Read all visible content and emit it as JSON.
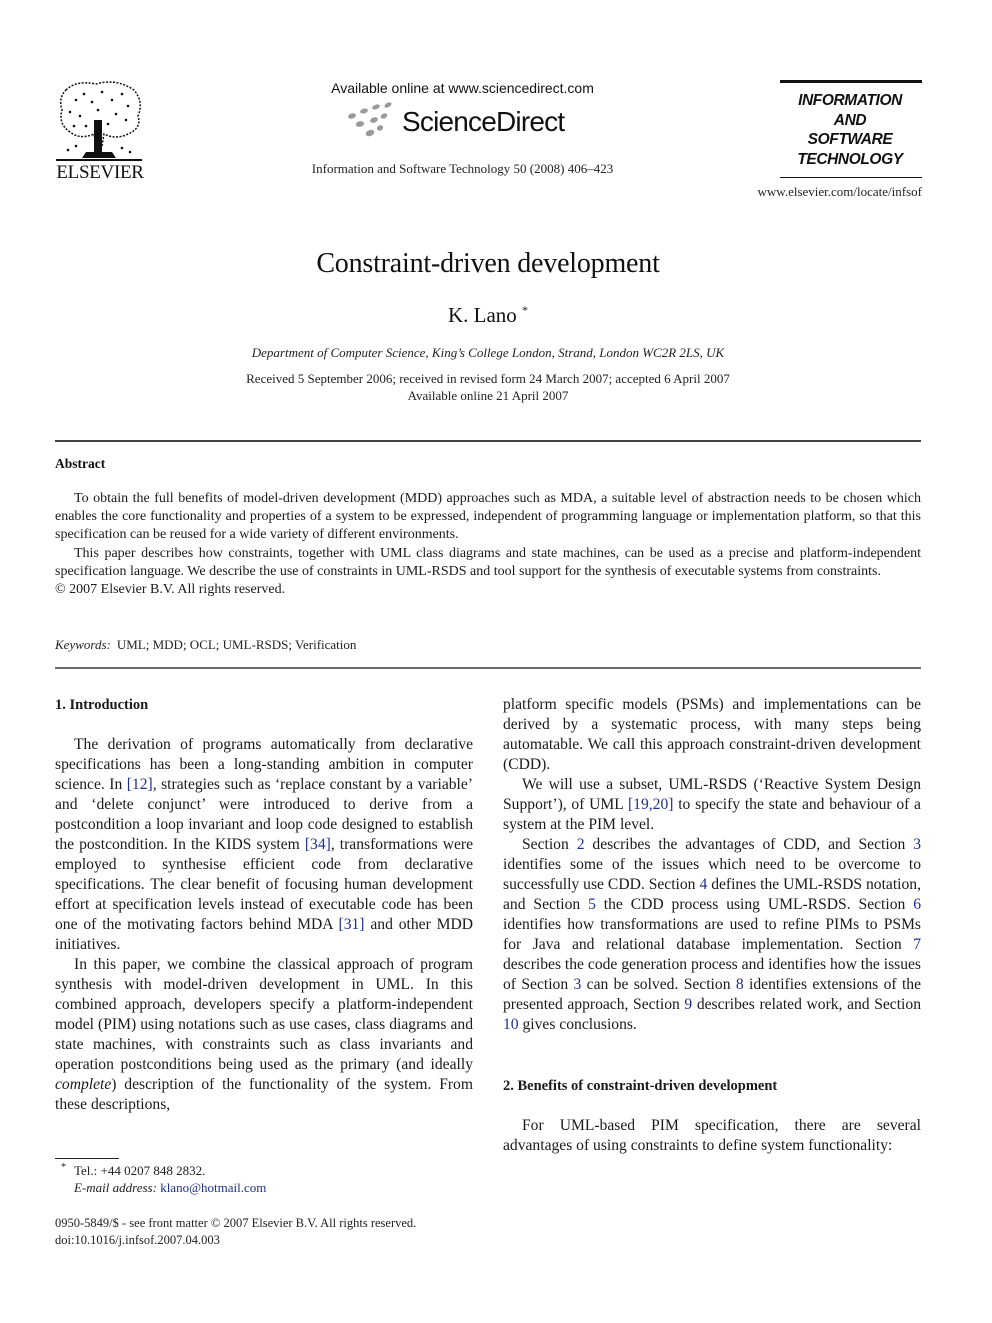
{
  "header": {
    "publisher_logo_icon": "elsevier-tree-icon",
    "publisher_name": "ELSEVIER",
    "available_online": "Available online at www.sciencedirect.com",
    "sciencedirect_logo_icon": "sciencedirect-dots-icon",
    "sciencedirect_name": "ScienceDirect",
    "journal_citation": "Information and Software Technology 50 (2008) 406–423",
    "journal_logo_lines": [
      "INFORMATION",
      "AND",
      "SOFTWARE",
      "TECHNOLOGY"
    ],
    "journal_url": "www.elsevier.com/locate/infsof"
  },
  "article": {
    "title": "Constraint-driven development",
    "author": "K. Lano",
    "author_mark": "*",
    "affiliation": "Department of Computer Science, King’s College London, Strand, London WC2R 2LS, UK",
    "received": "Received 5 September 2006; received in revised form 24 March 2007; accepted 6 April 2007",
    "available": "Available online 21 April 2007"
  },
  "abstract": {
    "heading": "Abstract",
    "paragraphs": [
      "To obtain the full benefits of model-driven development (MDD) approaches such as MDA, a suitable level of abstraction needs to be chosen which enables the core functionality and properties of a system to be expressed, independent of programming language or implementation platform, so that this specification can be reused for a wide variety of different environments.",
      "This paper describes how constraints, together with UML class diagrams and state machines, can be used as a precise and platform-independent specification language. We describe the use of constraints in UML-RSDS and tool support for the synthesis of executable systems from constraints."
    ],
    "copyright": "© 2007 Elsevier B.V. All rights reserved.",
    "keywords_label": "Keywords:",
    "keywords": "UML; MDD; OCL; UML-RSDS; Verification"
  },
  "body": {
    "sec1_heading": "1. Introduction",
    "p1": {
      "a": "The derivation of programs automatically from declarative specifications has been a long-standing ambition in computer science. In ",
      "ref1": "[12]",
      "b": ", strategies such as ‘replace constant by a variable’ and ‘delete conjunct’ were introduced to derive from a postcondition a loop invariant and loop code designed to establish the postcondition. In the KIDS system ",
      "ref2": "[34]",
      "c": ", transformations were employed to synthesise efficient code from declarative specifications. The clear benefit of focusing human development effort at specification levels instead of executable code has been one of the motivating factors behind MDA ",
      "ref3": "[31]",
      "d": " and other MDD initiatives."
    },
    "p2": {
      "a": "In this paper, we combine the classical approach of program synthesis with model-driven development in UML. In this combined approach, developers specify a platform-independent model (PIM) using notations such as use cases, class diagrams and state machines, with constraints such as class invariants and operation postconditions being used as the primary (and ideally ",
      "em": "complete",
      "b": ") description of the functionality of the system. From these descriptions,"
    },
    "p3": "platform specific models (PSMs) and implementations can be derived by a systematic process, with many steps being automatable. We call this approach constraint-driven development (CDD).",
    "p4": {
      "a": "We will use a subset, UML-RSDS (‘Reactive System Design Support’), of UML ",
      "ref": "[19,20]",
      "b": " to specify the state and behaviour of a system at the PIM level."
    },
    "p5": {
      "t0": "Section ",
      "s2": "2",
      "t1": " describes the advantages of CDD, and Section ",
      "s3": "3",
      "t2": " identifies some of the issues which need to be overcome to successfully use CDD. Section ",
      "s4": "4",
      "t3": " defines the UML-RSDS notation, and Section ",
      "s5": "5",
      "t4": " the CDD process using UML-RSDS. Section ",
      "s6": "6",
      "t5": " identifies how transformations are used to refine PIMs to PSMs for Java and relational database implementation. Section ",
      "s7": "7",
      "t6": " describes the code generation process and identifies how the issues of Section ",
      "s3b": "3",
      "t7": " can be solved. Section ",
      "s8": "8",
      "t8": " identifies extensions of the presented approach, Section ",
      "s9": "9",
      "t9": " describes related work, and Section ",
      "s10": "10",
      "t10": " gives conclusions."
    },
    "sec2_heading": "2. Benefits of constraint-driven development",
    "p6": "For UML-based PIM specification, there are several advantages of using constraints to define system functionality:"
  },
  "footnote": {
    "mark": "*",
    "tel": "Tel.: +44 0207 848 2832.",
    "email_label": "E-mail address:",
    "email": "klano@hotmail.com"
  },
  "frontmatter": {
    "issn": "0950-5849/$ - see front matter © 2007 Elsevier B.V. All rights reserved.",
    "doi": "doi:10.1016/j.infsof.2007.04.003"
  },
  "colors": {
    "link": "#1f2f8f",
    "text": "#1a1a1a"
  }
}
